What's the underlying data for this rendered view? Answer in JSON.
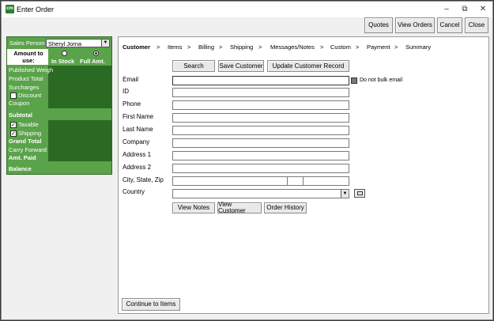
{
  "window": {
    "app_icon_text": "cm",
    "title": "Enter Order",
    "controls": {
      "minimize": "–",
      "restore": "⧉",
      "close": "✕"
    }
  },
  "toolbar": {
    "quotes_label": "Quotes",
    "view_orders_label": "View Orders",
    "cancel_label": "Cancel",
    "close_label": "Close"
  },
  "summary": {
    "sales_person_label": "Sales Person",
    "sales_person_value": "Sheryl Jorna",
    "amount_to_use_label": "Amount to use:",
    "in_stock_label": "In Stock",
    "full_amt_label": "Full Amt.",
    "amount_selected": "Full Amt.",
    "published_weight_label": "Published Weigh",
    "product_total_label": "Product Total",
    "surcharges_label": "Surcharges",
    "discount_label": "Discount",
    "coupon_label": "Coupon",
    "subtotal_label": "Subtotal",
    "taxable_label": "Taxable",
    "taxable_checked": true,
    "shipping_label": "Shipping",
    "shipping_checked": true,
    "grand_total_label": "Grand Total",
    "carry_forward_label": "Carry Forward",
    "amt_paid_label": "Amt. Paid",
    "balance_label": "Balance"
  },
  "breadcrumbs": {
    "customer": "Customer",
    "items": "Items",
    "billing": "Billing",
    "shipping": "Shipping",
    "messages": "Messages/Notes",
    "custom": "Custom",
    "payment": "Payment",
    "summary": "Summary",
    "separator": ">"
  },
  "customer_form": {
    "search_label": "Search",
    "save_customer_label": "Save Customer",
    "update_customer_label": "Update Customer Record",
    "email_label": "Email",
    "email_value": "",
    "do_not_bulk_email_label": "Do not bulk email",
    "id_label": "ID",
    "phone_label": "Phone",
    "first_name_label": "First Name",
    "last_name_label": "Last Name",
    "company_label": "Company",
    "address1_label": "Address 1",
    "address2_label": "Address 2",
    "city_state_zip_label": "City, State, Zip",
    "country_label": "Country",
    "view_notes_label": "View Notes",
    "view_customer_label": "View Customer",
    "order_history_label": "Order History"
  },
  "footer": {
    "continue_label": "Continue to Items"
  },
  "colors": {
    "panel_green": "#5aa34a",
    "panel_dark_green": "#2b6a22"
  }
}
